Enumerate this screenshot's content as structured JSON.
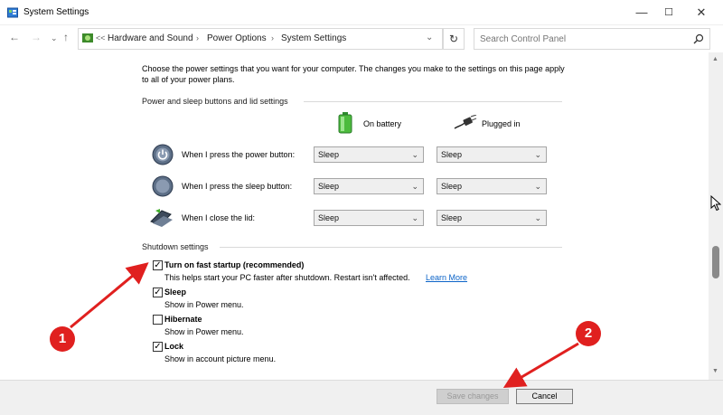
{
  "window": {
    "title": "System Settings",
    "app_icon": "control-panel-icon"
  },
  "address": {
    "prefix": "<<",
    "crumbs": [
      "Hardware and Sound",
      "Power Options",
      "System Settings"
    ],
    "refresh": "↻",
    "search_placeholder": "Search Control Panel"
  },
  "content": {
    "intro": "Choose the power settings that you want for your computer. The changes you make to the settings on this page apply to all of your power plans.",
    "section1": "Power and sleep buttons and lid settings",
    "on_battery": "On battery",
    "plugged_in": "Plugged in",
    "rows": [
      {
        "label": "When I press the power button:",
        "battery": "Sleep",
        "plugged": "Sleep",
        "icon": "power-button-icon"
      },
      {
        "label": "When I press the sleep button:",
        "battery": "Sleep",
        "plugged": "Sleep",
        "icon": "sleep-button-icon"
      },
      {
        "label": "When I close the lid:",
        "battery": "Sleep",
        "plugged": "Sleep",
        "icon": "laptop-lid-icon"
      }
    ],
    "section2": "Shutdown settings",
    "options": [
      {
        "title": "Turn on fast startup (recommended)",
        "desc": "This helps start your PC faster after shutdown. Restart isn't affected.",
        "link": "Learn More",
        "checked": true
      },
      {
        "title": "Sleep",
        "desc": "Show in Power menu.",
        "checked": true
      },
      {
        "title": "Hibernate",
        "desc": "Show in Power menu.",
        "checked": false
      },
      {
        "title": "Lock",
        "desc": "Show in account picture menu.",
        "checked": true
      }
    ]
  },
  "buttons": {
    "save": "Save changes",
    "cancel": "Cancel"
  },
  "callouts": [
    "1",
    "2"
  ],
  "colors": {
    "accent": "#e0201f",
    "link": "#0c64c8"
  }
}
